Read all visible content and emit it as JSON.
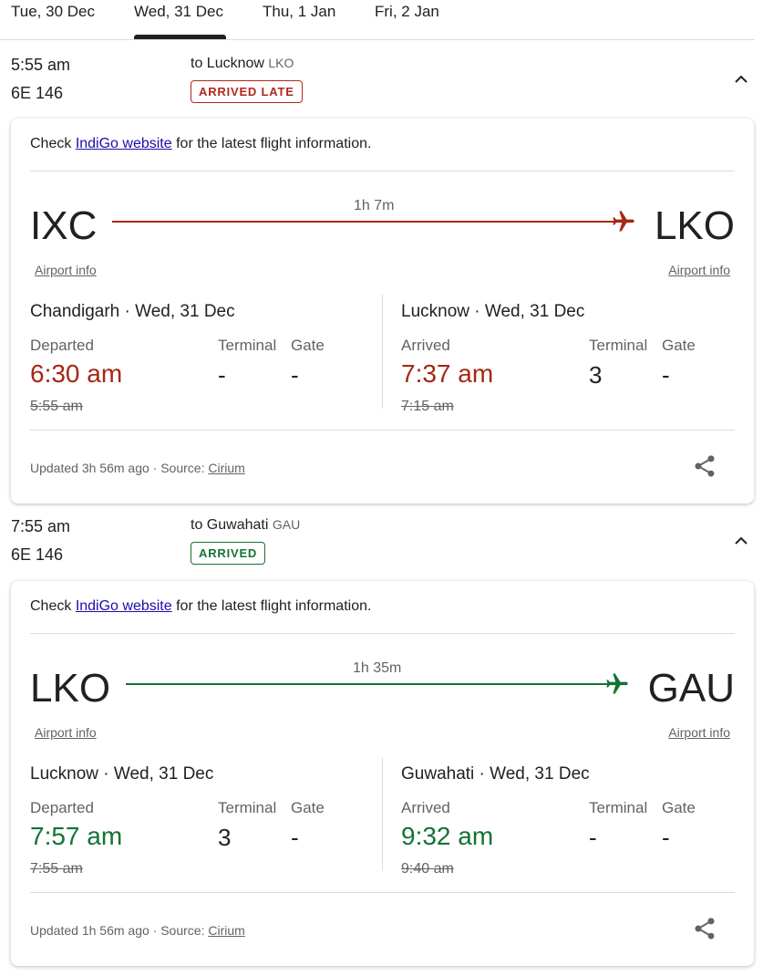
{
  "date_tabs": [
    {
      "label": "Tue, 30 Dec"
    },
    {
      "label": "Wed, 31 Dec",
      "selected": true
    },
    {
      "label": "Thu, 1 Jan"
    },
    {
      "label": "Fri, 2 Jan"
    }
  ],
  "flights": [
    {
      "dep_time": "5:55 am",
      "flight_no": "6E 146",
      "to_prefix": "to Lucknow",
      "to_code": "LKO",
      "status": "ARRIVED LATE",
      "status_color": "#b3261e",
      "check_pre": "Check",
      "check_link": "IndiGo website",
      "check_post": "for the latest flight information.",
      "origin": "IXC",
      "destination": "LKO",
      "duration": "1h 7m",
      "route_color": "#a52714",
      "airport_info": "Airport info",
      "depart": {
        "city": "Chandigarh · Wed, 31 Dec",
        "label": "Departed",
        "time": "6:30 am",
        "time_color": "#a52714",
        "scheduled": "5:55 am",
        "terminal_label": "Terminal",
        "terminal": "-",
        "gate_label": "Gate",
        "gate": "-"
      },
      "arrive": {
        "city": "Lucknow · Wed, 31 Dec",
        "label": "Arrived",
        "time": "7:37 am",
        "time_color": "#a52714",
        "scheduled": "7:15 am",
        "terminal_label": "Terminal",
        "terminal": "3",
        "gate_label": "Gate",
        "gate": "-"
      },
      "updated": "Updated 3h 56m ago",
      "source_label": "Source:",
      "source": "Cirium"
    },
    {
      "dep_time": "7:55 am",
      "flight_no": "6E 146",
      "to_prefix": "to Guwahati",
      "to_code": "GAU",
      "status": "ARRIVED",
      "status_color": "#137333",
      "check_pre": "Check",
      "check_link": "IndiGo website",
      "check_post": "for the latest flight information.",
      "origin": "LKO",
      "destination": "GAU",
      "duration": "1h 35m",
      "route_color": "#137333",
      "airport_info": "Airport info",
      "depart": {
        "city": "Lucknow · Wed, 31 Dec",
        "label": "Departed",
        "time": "7:57 am",
        "time_color": "#137333",
        "scheduled": "7:55 am",
        "terminal_label": "Terminal",
        "terminal": "3",
        "gate_label": "Gate",
        "gate": "-"
      },
      "arrive": {
        "city": "Guwahati · Wed, 31 Dec",
        "label": "Arrived",
        "time": "9:32 am",
        "time_color": "#137333",
        "scheduled": "9:40 am",
        "terminal_label": "Terminal",
        "terminal": "-",
        "gate_label": "Gate",
        "gate": "-"
      },
      "updated": "Updated 1h 56m ago",
      "source_label": "Source:",
      "source": "Cirium"
    }
  ]
}
